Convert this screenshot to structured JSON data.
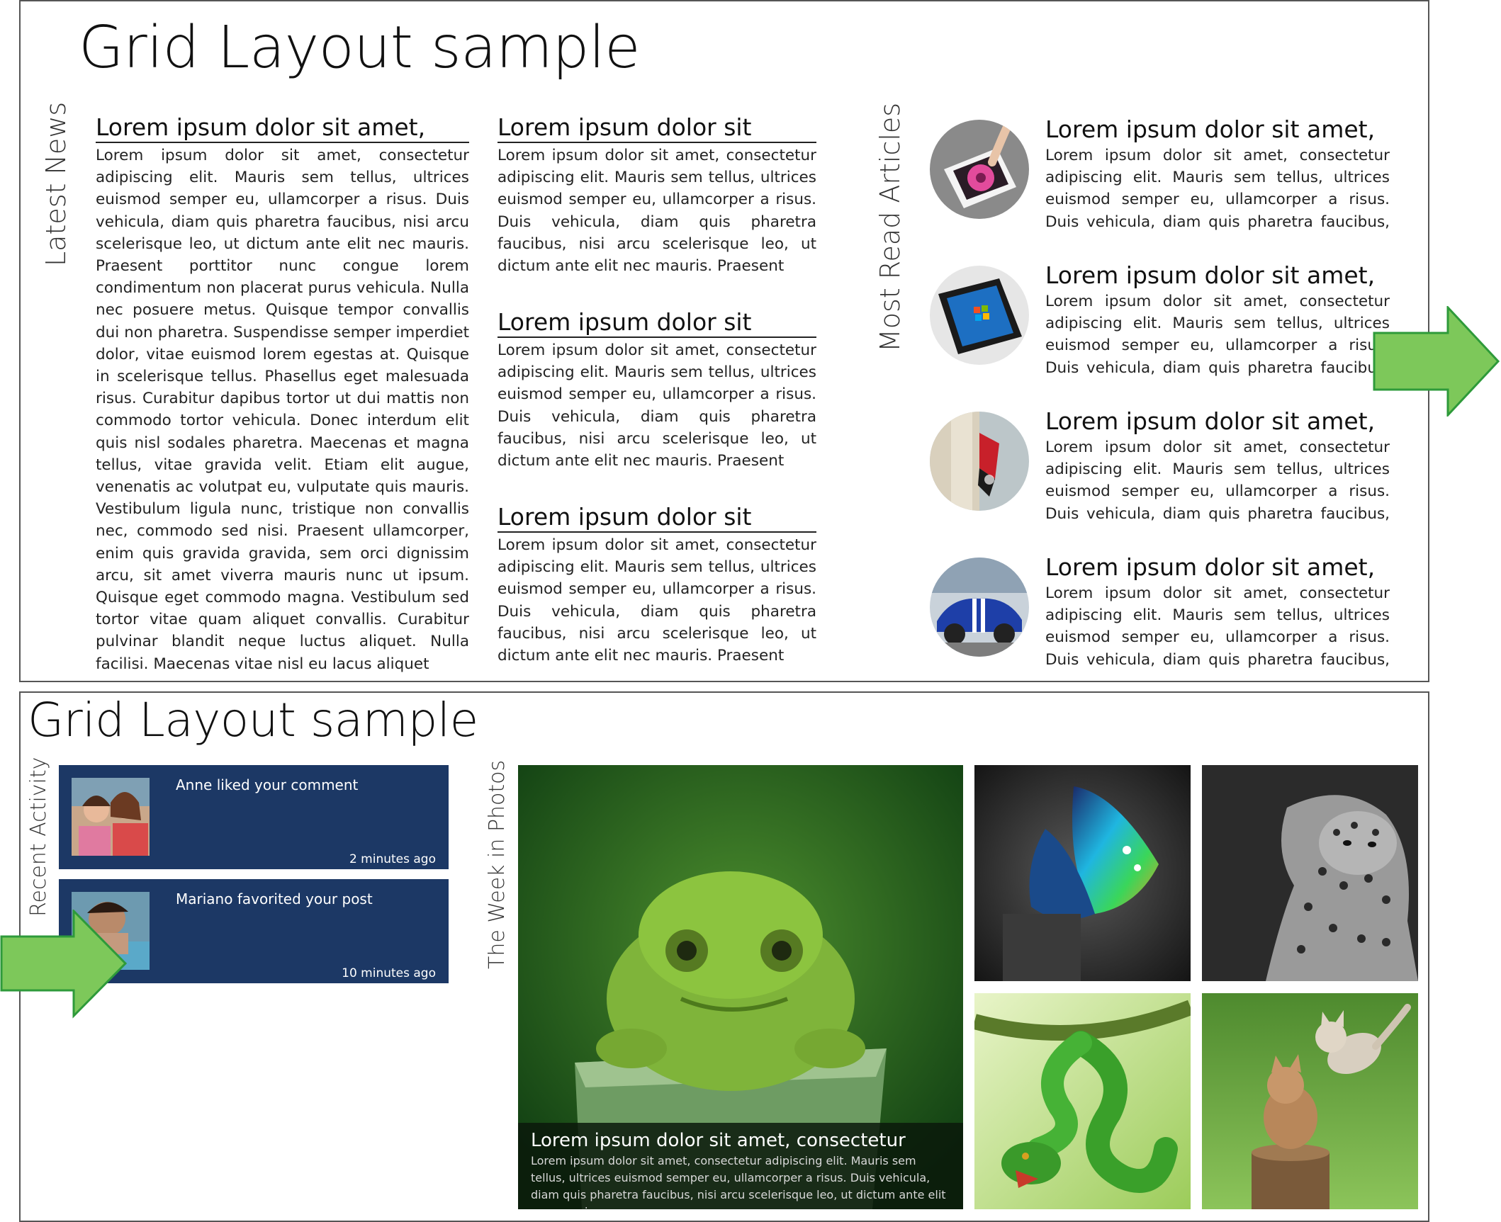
{
  "top": {
    "title": "Grid Layout sample",
    "latest_news_label": "Latest News",
    "most_read_label": "Most Read Articles",
    "col1": {
      "heading": "Lorem ipsum dolor sit amet,",
      "body": "Lorem ipsum dolor sit amet, consectetur adipiscing elit. Mauris sem tellus, ultrices euismod semper eu, ullamcorper a risus. Duis vehicula, diam quis pharetra faucibus, nisi arcu scelerisque leo, ut dictum ante elit nec mauris. Praesent porttitor nunc congue lorem condimentum non placerat purus vehicula. Nulla nec posuere metus. Quisque tempor convallis dui non pharetra. Suspendisse semper imperdiet dolor, vitae euismod lorem egestas at. Quisque in scelerisque tellus. Phasellus eget malesuada risus. Curabitur dapibus tortor ut dui mattis non commodo tortor vehicula. Donec interdum elit quis nisl sodales pharetra. Maecenas et magna tellus, vitae gravida velit. Etiam elit augue, venenatis ac volutpat eu, vulputate quis mauris. Vestibulum ligula nunc, tristique non convallis nec, commodo sed nisi. Praesent ullamcorper, enim quis gravida gravida, sem orci dignissim arcu, sit amet viverra mauris nunc ut ipsum. Quisque eget commodo magna. Vestibulum sed tortor vitae quam aliquet convallis. Curabitur pulvinar blandit neque luctus aliquet. Nulla facilisi. Maecenas vitae nisl eu lacus aliquet"
    },
    "col2": [
      {
        "heading": "Lorem ipsum dolor sit",
        "body": "Lorem ipsum dolor sit amet, consectetur adipiscing elit. Mauris sem tellus, ultrices euismod semper eu, ullamcorper a risus. Duis vehicula, diam quis pharetra faucibus, nisi arcu scelerisque leo, ut dictum ante elit nec mauris. Praesent"
      },
      {
        "heading": "Lorem ipsum dolor sit",
        "body": "Lorem ipsum dolor sit amet, consectetur adipiscing elit. Mauris sem tellus, ultrices euismod semper eu, ullamcorper a risus. Duis vehicula, diam quis pharetra faucibus, nisi arcu scelerisque leo, ut dictum ante elit nec mauris. Praesent"
      },
      {
        "heading": "Lorem ipsum dolor sit",
        "body": "Lorem ipsum dolor sit amet, consectetur adipiscing elit. Mauris sem tellus, ultrices euismod semper eu, ullamcorper a risus. Duis vehicula, diam quis pharetra faucibus, nisi arcu scelerisque leo, ut dictum ante elit nec mauris. Praesent"
      }
    ],
    "articles": [
      {
        "title": "Lorem ipsum dolor sit amet,",
        "body": "Lorem ipsum dolor sit amet, consectetur adipiscing elit. Mauris sem tellus, ultrices euismod semper eu, ullamcorper a risus. Duis vehicula, diam quis pharetra faucibus, nisi arcu",
        "image": "tablet-flower-photo"
      },
      {
        "title": "Lorem ipsum dolor sit amet,",
        "body": "Lorem ipsum dolor sit amet, consectetur adipiscing elit. Mauris sem tellus, ultrices euismod semper eu, ullamcorper a risus. Duis vehicula, diam quis pharetra faucibus, nisi arcu",
        "image": "windows-tablet-photo"
      },
      {
        "title": "Lorem ipsum dolor sit amet,",
        "body": "Lorem ipsum dolor sit amet, consectetur adipiscing elit. Mauris sem tellus, ultrices euismod semper eu, ullamcorper a risus. Duis vehicula, diam quis pharetra faucibus, nisi arcu",
        "image": "butterfly-photo"
      },
      {
        "title": "Lorem ipsum dolor sit amet,",
        "body": "Lorem ipsum dolor sit amet, consectetur adipiscing elit. Mauris sem tellus, ultrices euismod semper eu, ullamcorper a risus. Duis vehicula, diam quis pharetra faucibus, nisi arcu",
        "image": "blue-car-photo"
      }
    ]
  },
  "bottom": {
    "title": "Grid Layout sample",
    "recent_activity_label": "Recent Activity",
    "photos_label": "The Week in Photos",
    "activity": [
      {
        "text": "Anne liked your comment",
        "time": "2 minutes ago",
        "image": "two-women-photo"
      },
      {
        "text": "Mariano favorited your post",
        "time": "10 minutes ago",
        "image": "man-portrait-photo"
      }
    ],
    "featured": {
      "title": "Lorem ipsum dolor sit amet, consectetur",
      "body": "Lorem ipsum dolor sit amet, consectetur adipiscing elit. Mauris sem tellus, ultrices euismod semper eu, ullamcorper a risus. Duis vehicula, diam quis pharetra faucibus, nisi arcu scelerisque leo, ut dictum ante elit nec mauris.",
      "image": "green-frog-photo"
    },
    "photos": [
      "iridescent-butterfly-photo",
      "leopard-photo",
      "green-snake-photo",
      "kittens-photo"
    ]
  },
  "colors": {
    "tile_background": "#1c3865",
    "arrow_fill": "#7dc85a",
    "arrow_stroke": "#2e9a3a",
    "frame_border": "#555555"
  }
}
